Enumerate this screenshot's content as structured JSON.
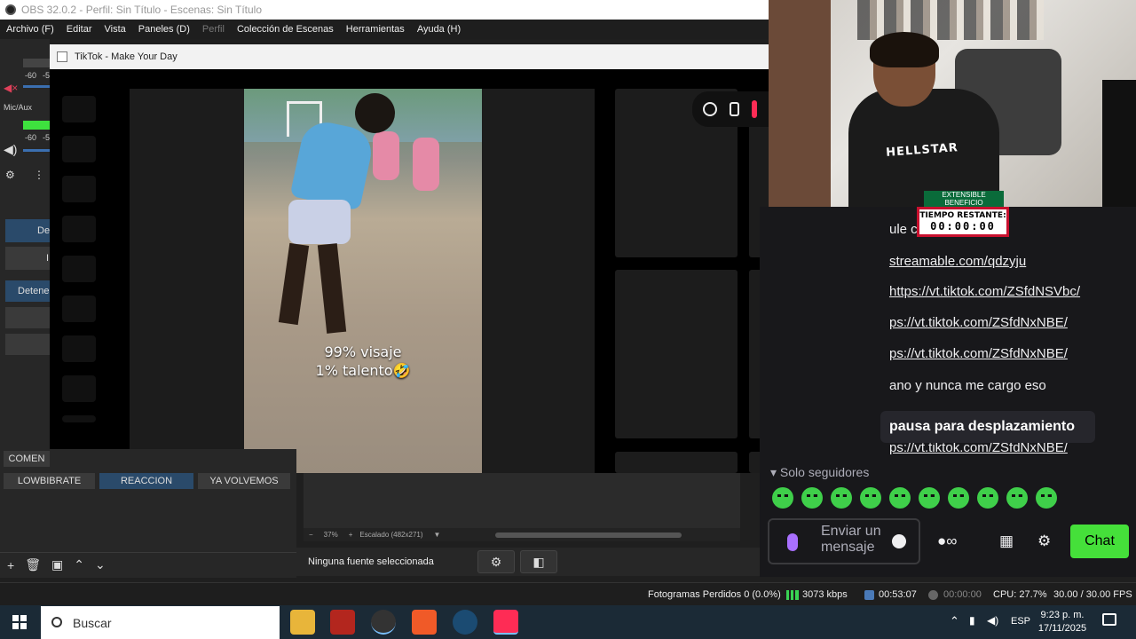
{
  "obs": {
    "title": "OBS 32.0.2 - Perfil: Sin Título - Escenas: Sin Título",
    "menu": [
      "Archivo (F)",
      "Editar",
      "Vista",
      "Paneles (D)",
      "Perfil",
      "Colección de Escenas",
      "Herramientas",
      "Ayuda (H)"
    ],
    "mic_label": "Mic/Aux",
    "meter_ticks": [
      "-60",
      "-5"
    ],
    "left_buttons": [
      "De",
      "I",
      "Detene"
    ],
    "scenes": [
      "COMEN",
      "LOWBIBRATE",
      "REACCION",
      "YA VOLVEMOS"
    ],
    "zoom": "37%",
    "scaled_label": "Escalado (482x271)",
    "no_source": "Ninguna fuente seleccionada",
    "status": {
      "dropped": "Fotogramas Perdidos 0 (0.0%)",
      "bitrate": "3073 kbps",
      "live_time": "00:53:07",
      "rec_time": "00:00:00",
      "cpu": "CPU: 27.7%",
      "fps": "30.00 / 30.00 FPS"
    }
  },
  "tiktok": {
    "window_title": "TikTok - Make Your Day",
    "caption_line1": "99% visaje",
    "caption_line2": "1% talento🤣"
  },
  "webcam": {
    "shirt_text": "HELLSTAR",
    "timer_top": "EXTENSIBLE BENEFICIO",
    "timer_label": "TIEMPO RESTANTE:",
    "timer_value": "00:00:00"
  },
  "chat": {
    "lines": [
      "ule c",
      "streamable.com/qdzyju",
      "https://vt.tiktok.com/ZSfdNSVbc/",
      "ps://vt.tiktok.com/ZSfdNxNBE/",
      "ps://vt.tiktok.com/ZSfdNxNBE/",
      "ano y nunca me cargo eso",
      "ps://vt.tiktok.com/ZSfdNxNBE/"
    ],
    "pause_banner": "pausa para desplazamiento",
    "followers_only": "Solo seguidores",
    "input_placeholder": "Enviar un mensaje",
    "chat_button": "Chat",
    "accent": "#45e03a"
  },
  "taskbar": {
    "search_placeholder": "Buscar",
    "lang": "ESP",
    "time": "9:23 p. m.",
    "date": "17/11/2025"
  }
}
